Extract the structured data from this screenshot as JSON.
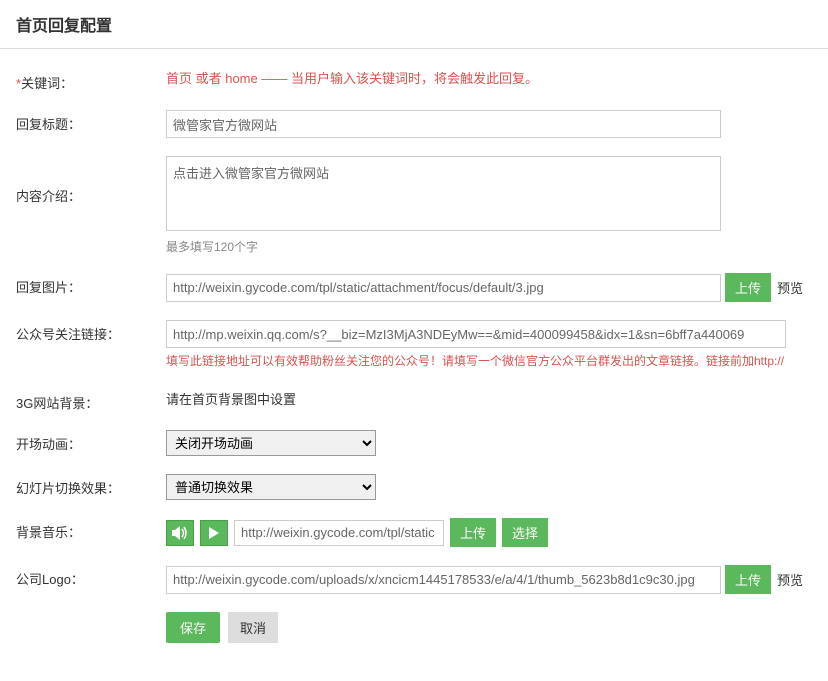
{
  "page": {
    "title": "首页回复配置"
  },
  "form": {
    "keyword": {
      "label": "关键词：",
      "required_mark": "*",
      "hint": "首页 或者 home —— 当用户输入该关键词时，将会触发此回复。"
    },
    "reply_title": {
      "label": "回复标题：",
      "value": "微管家官方微网站"
    },
    "content_intro": {
      "label": "内容介绍：",
      "value": "点击进入微管家官方微网站",
      "hint": "最多填写120个字"
    },
    "reply_image": {
      "label": "回复图片：",
      "value": "http://weixin.gycode.com/tpl/static/attachment/focus/default/3.jpg",
      "upload_btn": "上传",
      "preview_btn": "预览"
    },
    "follow_link": {
      "label": "公众号关注链接：",
      "value": "http://mp.weixin.qq.com/s?__biz=MzI3MjA3NDEyMw==&mid=400099458&idx=1&sn=6bff7a440069",
      "hint": "填写此链接地址可以有效帮助粉丝关注您的公众号！请填写一个微信官方公众平台群发出的文章链接。链接前加http://"
    },
    "site_bg": {
      "label": "3G网站背景：",
      "text": "请在首页背景图中设置"
    },
    "open_anim": {
      "label": "开场动画：",
      "selected": "关闭开场动画"
    },
    "slide_effect": {
      "label": "幻灯片切换效果：",
      "selected": "普通切换效果"
    },
    "bg_music": {
      "label": "背景音乐：",
      "value": "http://weixin.gycode.com/tpl/static",
      "upload_btn": "上传",
      "select_btn": "选择"
    },
    "company_logo": {
      "label": "公司Logo：",
      "value": "http://weixin.gycode.com/uploads/x/xncicm1445178533/e/a/4/1/thumb_5623b8d1c9c30.jpg",
      "upload_btn": "上传",
      "preview_btn": "预览"
    },
    "actions": {
      "save": "保存",
      "cancel": "取消"
    }
  }
}
